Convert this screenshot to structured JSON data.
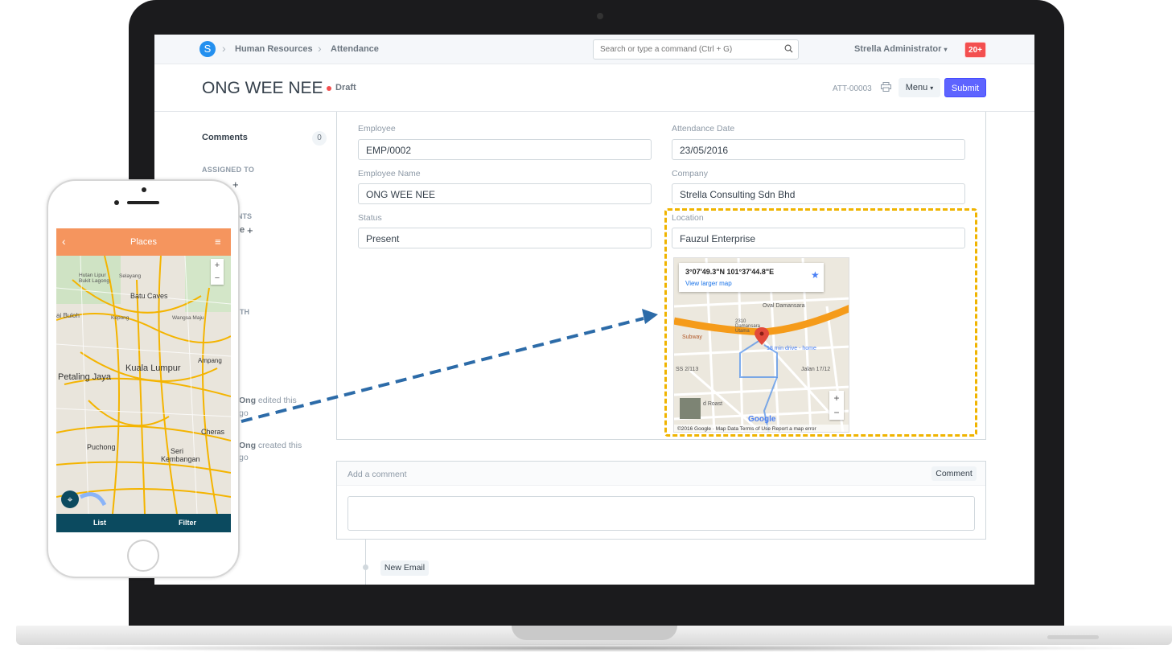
{
  "navbar": {
    "logo_letter": "S",
    "breadcrumbs": [
      "Human Resources",
      "Attendance"
    ],
    "search_placeholder": "Search or type a command (Ctrl + G)",
    "user": "Strella Administrator",
    "notification_badge": "20+"
  },
  "page": {
    "title": "ONG WEE NEE",
    "status": "Draft",
    "doc_id": "ATT-00003",
    "menu_label": "Menu",
    "submit_label": "Submit"
  },
  "sidebar": {
    "comments_label": "Comments",
    "comments_count": "0",
    "assigned_to_label": "ASSIGNED TO",
    "fragments": [
      "NTS",
      "e",
      "TH"
    ],
    "activity": [
      {
        "user": "Ong",
        "action": "edited this",
        "time": "go"
      },
      {
        "user": "Ong",
        "action": "created this",
        "time": "go"
      }
    ]
  },
  "form": {
    "employee": {
      "label": "Employee",
      "value": "EMP/0002"
    },
    "attendance_date": {
      "label": "Attendance Date",
      "value": "23/05/2016"
    },
    "employee_name": {
      "label": "Employee Name",
      "value": "ONG WEE NEE"
    },
    "company": {
      "label": "Company",
      "value": "Strella Consulting Sdn Bhd"
    },
    "status": {
      "label": "Status",
      "value": "Present"
    },
    "location": {
      "label": "Location",
      "value": "Fauzul Enterprise"
    }
  },
  "map": {
    "coords": "3°07'49.3\"N 101°37'44.8\"E",
    "view_larger": "View larger map",
    "labels": [
      "Oval Damansara",
      "Subway",
      "18 min drive - home",
      "SS 2/113",
      "Jalan 17/12",
      "2310 Damansara Utama",
      "d Roast"
    ],
    "brand": "Google",
    "footer": "©2016 Google · Map Data   Terms of Use   Report a map error",
    "zoom_in": "+",
    "zoom_out": "−"
  },
  "comments": {
    "placeholder": "Add a comment",
    "button": "Comment",
    "new_email": "New Email"
  },
  "phone": {
    "title": "Places",
    "tabs": [
      "List",
      "Filter"
    ],
    "map_labels": [
      "Batu Caves",
      "Kuala Lumpur",
      "Petaling Jaya",
      "Ampang",
      "Cheras",
      "Puchong",
      "Seri Kembangan",
      "Selayang",
      "ai Buloh",
      "Kepong",
      "Wangsa Maju",
      "Hutan Lipur Bukit Lagong"
    ],
    "zoom_in": "+",
    "zoom_out": "−"
  },
  "colors": {
    "primary": "#5e64ff",
    "badge": "#f34f4f",
    "highlight": "#f0b400",
    "arrow": "#2c6ba8",
    "phone_header": "#f5955e",
    "phone_tabs": "#0b4a5f"
  }
}
